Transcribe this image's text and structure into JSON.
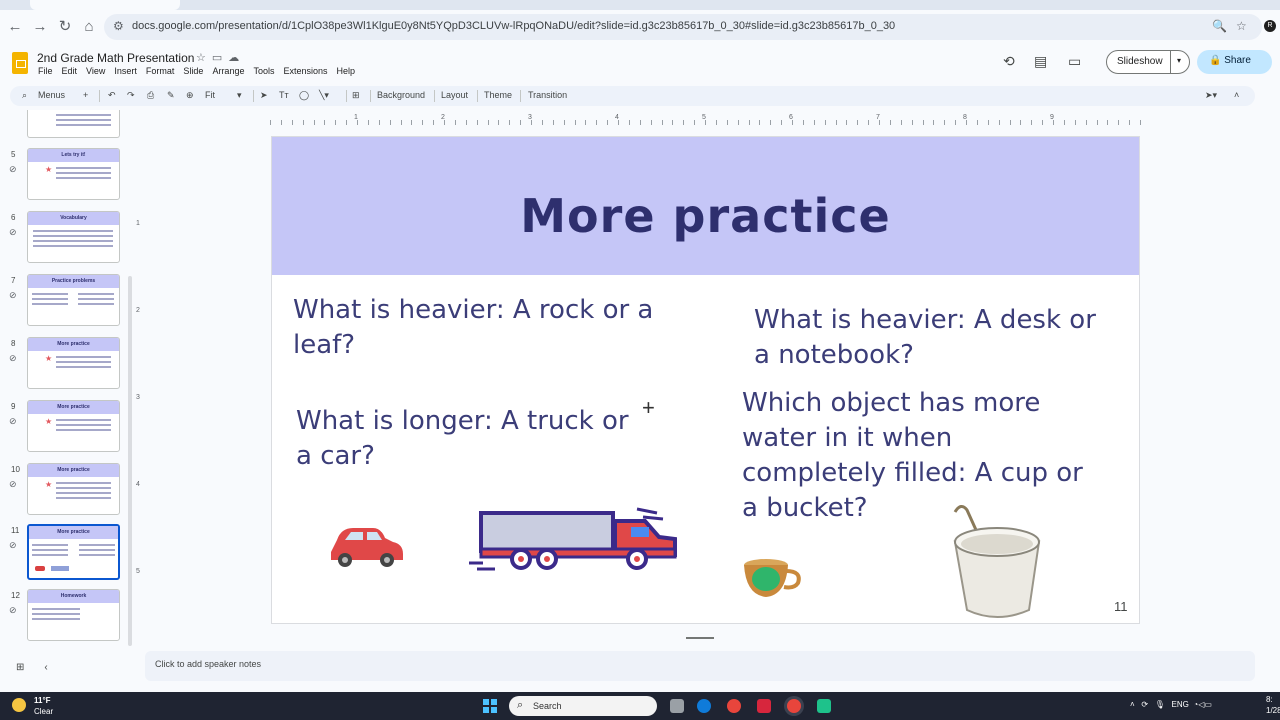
{
  "browser": {
    "url": "docs.google.com/presentation/d/1CplO38pe3Wl1KlguE0y8Nt5YQpD3CLUVw-lRpqONaDU/edit?slide=id.g3c23b85617b_0_30#slide=id.g3c23b85617b_0_30"
  },
  "doc": {
    "title": "2nd Grade Math Presentation",
    "menu": [
      "File",
      "Edit",
      "View",
      "Insert",
      "Format",
      "Slide",
      "Arrange",
      "Tools",
      "Extensions",
      "Help"
    ],
    "slideshow_label": "Slideshow",
    "share_label": "Share"
  },
  "toolbar": {
    "menus_label": "Menus",
    "zoom": "Fit",
    "background_label": "Background",
    "layout_label": "Layout",
    "theme_label": "Theme",
    "transition_label": "Transition"
  },
  "filmstrip": [
    {
      "num": "5",
      "title": "Lets try it!"
    },
    {
      "num": "6",
      "title": "Vocabulary"
    },
    {
      "num": "7",
      "title": "Practice problems"
    },
    {
      "num": "8",
      "title": "More practice"
    },
    {
      "num": "9",
      "title": "More practice"
    },
    {
      "num": "10",
      "title": "More practice"
    },
    {
      "num": "11",
      "title": "More practice"
    },
    {
      "num": "12",
      "title": "Homework"
    }
  ],
  "ruler": {
    "h": [
      "1",
      "2",
      "3",
      "4",
      "5",
      "6",
      "7",
      "8",
      "9"
    ],
    "v": [
      "1",
      "2",
      "3",
      "4",
      "5"
    ]
  },
  "slide": {
    "title": "More practice",
    "q1": "What is heavier: A rock or a leaf?",
    "q2": "What is heavier: A desk or a notebook?",
    "q3": "What is longer: A truck or a car?",
    "q4": "Which object has more water in it when completely filled: A cup or a bucket?",
    "number": "11"
  },
  "notes_placeholder": "Click to add speaker notes",
  "taskbar": {
    "temp": "11°F",
    "condition": "Clear",
    "search_label": "Search",
    "lang": "ENG",
    "time": "8:",
    "date": "1/28"
  }
}
